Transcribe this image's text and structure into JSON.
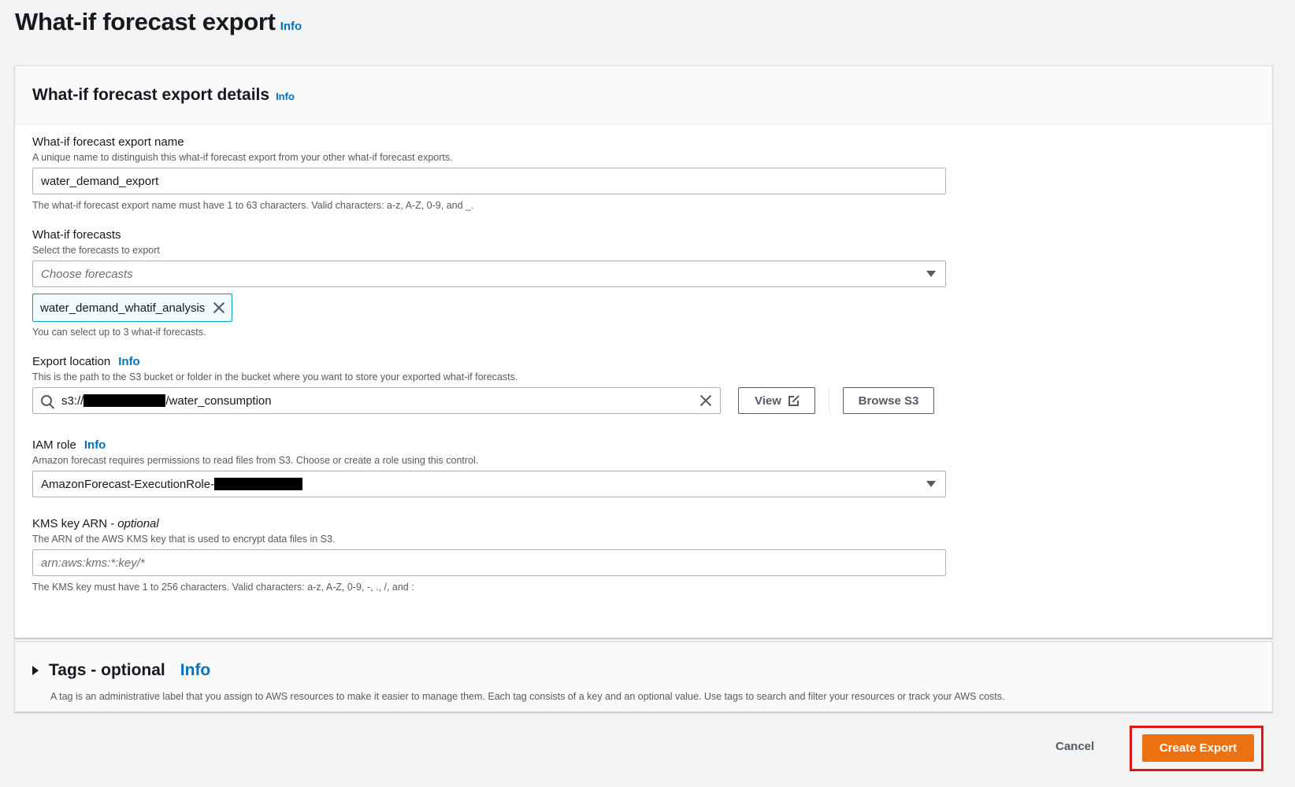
{
  "page": {
    "title": "What-if forecast export",
    "info": "Info"
  },
  "details": {
    "title": "What-if forecast export details",
    "info": "Info",
    "export_name": {
      "label": "What-if forecast export name",
      "description": "A unique name to distinguish this what-if forecast export from your other what-if forecast exports.",
      "value": "water_demand_export",
      "constraint": "The what-if forecast export name must have 1 to 63 characters. Valid characters: a-z, A-Z, 0-9, and _."
    },
    "forecasts": {
      "label": "What-if forecasts",
      "description": "Select the forecasts to export",
      "placeholder": "Choose forecasts",
      "selected_token": "water_demand_whatif_analysis",
      "constraint": "You can select up to 3 what-if forecasts."
    },
    "export_location": {
      "label": "Export location",
      "info": "Info",
      "description": "This is the path to the S3 bucket or folder in the bucket where you want to store your exported what-if forecasts.",
      "value_prefix": "s3://",
      "value_suffix": "/water_consumption",
      "view_button": "View",
      "browse_button": "Browse S3"
    },
    "iam_role": {
      "label": "IAM role",
      "info": "Info",
      "description": "Amazon forecast requires permissions to read files from S3. Choose or create a role using this control.",
      "value": "AmazonForecast-ExecutionRole-"
    },
    "kms_key": {
      "label": "KMS key ARN - ",
      "optional": "optional",
      "description": "The ARN of the AWS KMS key that is used to encrypt data files in S3.",
      "placeholder": "arn:aws:kms:*:key/*",
      "constraint": "The KMS key must have 1 to 256 characters. Valid characters: a-z, A-Z, 0-9, -, ., /, and :"
    }
  },
  "tags": {
    "title": "Tags - optional",
    "info": "Info",
    "description": "A tag is an administrative label that you assign to AWS resources to make it easier to manage them. Each tag consists of a key and an optional value. Use tags to search and filter your resources or track your AWS costs."
  },
  "actions": {
    "cancel": "Cancel",
    "create": "Create Export"
  },
  "colors": {
    "primary_button": "#ec7211",
    "link": "#0073bb",
    "highlight": "#e4141e"
  }
}
